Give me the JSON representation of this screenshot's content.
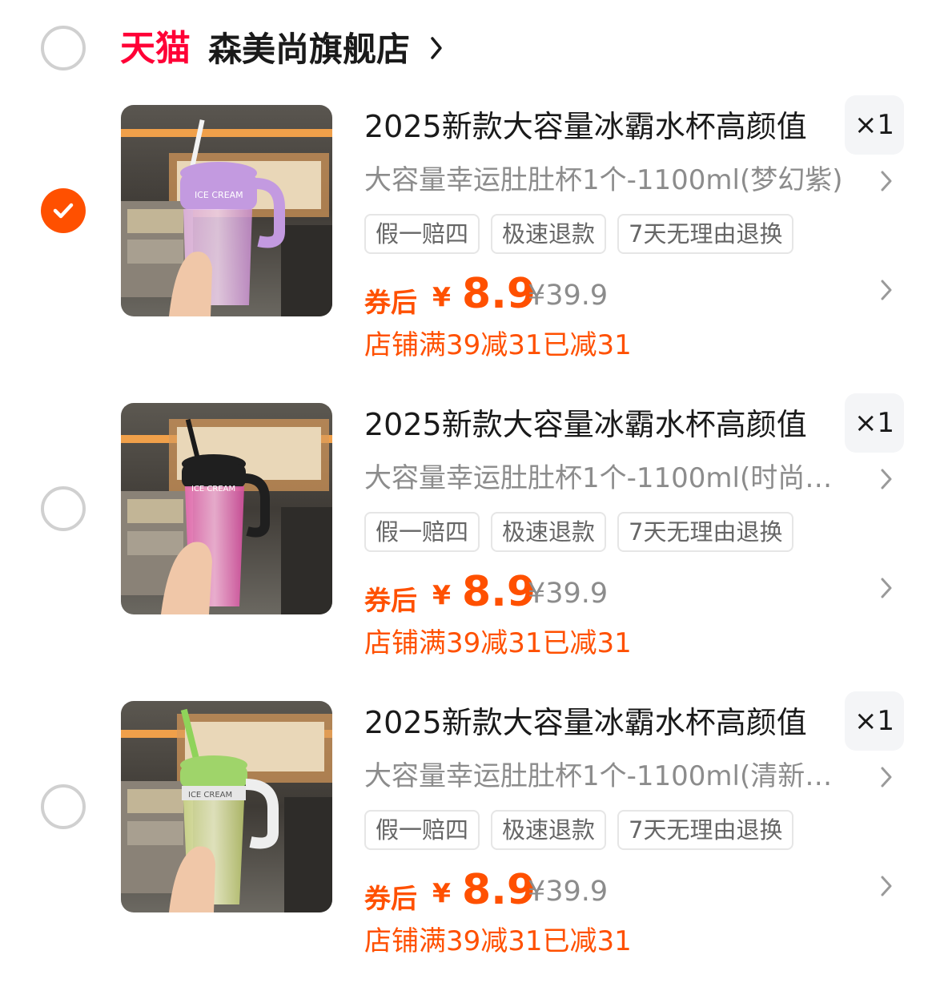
{
  "store": {
    "brand_logo_text": "天猫",
    "name": "森美尚旗舰店",
    "selected": false
  },
  "colors": {
    "accent": "#ff5000",
    "brand_red": "#ff0036",
    "muted_text": "#8c8c8c"
  },
  "items": [
    {
      "selected": true,
      "thumb_variant": "purple",
      "title": "2025新款大容量冰霸水杯高颜值",
      "quantity": "×1",
      "sku": "大容量幸运肚肚杯1个-1100ml(梦幻紫)",
      "tags": [
        "假一赔四",
        "极速退款",
        "7天无理由退换"
      ],
      "price_label": "券后",
      "currency": "¥",
      "price": "8.9",
      "original_price": "¥39.9",
      "promo": "店铺满39减31已减31"
    },
    {
      "selected": false,
      "thumb_variant": "pink",
      "title": "2025新款大容量冰霸水杯高颜值",
      "quantity": "×1",
      "sku": "大容量幸运肚肚杯1个-1100ml(时尚…",
      "tags": [
        "假一赔四",
        "极速退款",
        "7天无理由退换"
      ],
      "price_label": "券后",
      "currency": "¥",
      "price": "8.9",
      "original_price": "¥39.9",
      "promo": "店铺满39减31已减31"
    },
    {
      "selected": false,
      "thumb_variant": "green",
      "title": "2025新款大容量冰霸水杯高颜值",
      "quantity": "×1",
      "sku": "大容量幸运肚肚杯1个-1100ml(清新…",
      "tags": [
        "假一赔四",
        "极速退款",
        "7天无理由退换"
      ],
      "price_label": "券后",
      "currency": "¥",
      "price": "8.9",
      "original_price": "¥39.9",
      "promo": "店铺满39减31已减31"
    }
  ],
  "product_image_text": "ICE CREAM"
}
